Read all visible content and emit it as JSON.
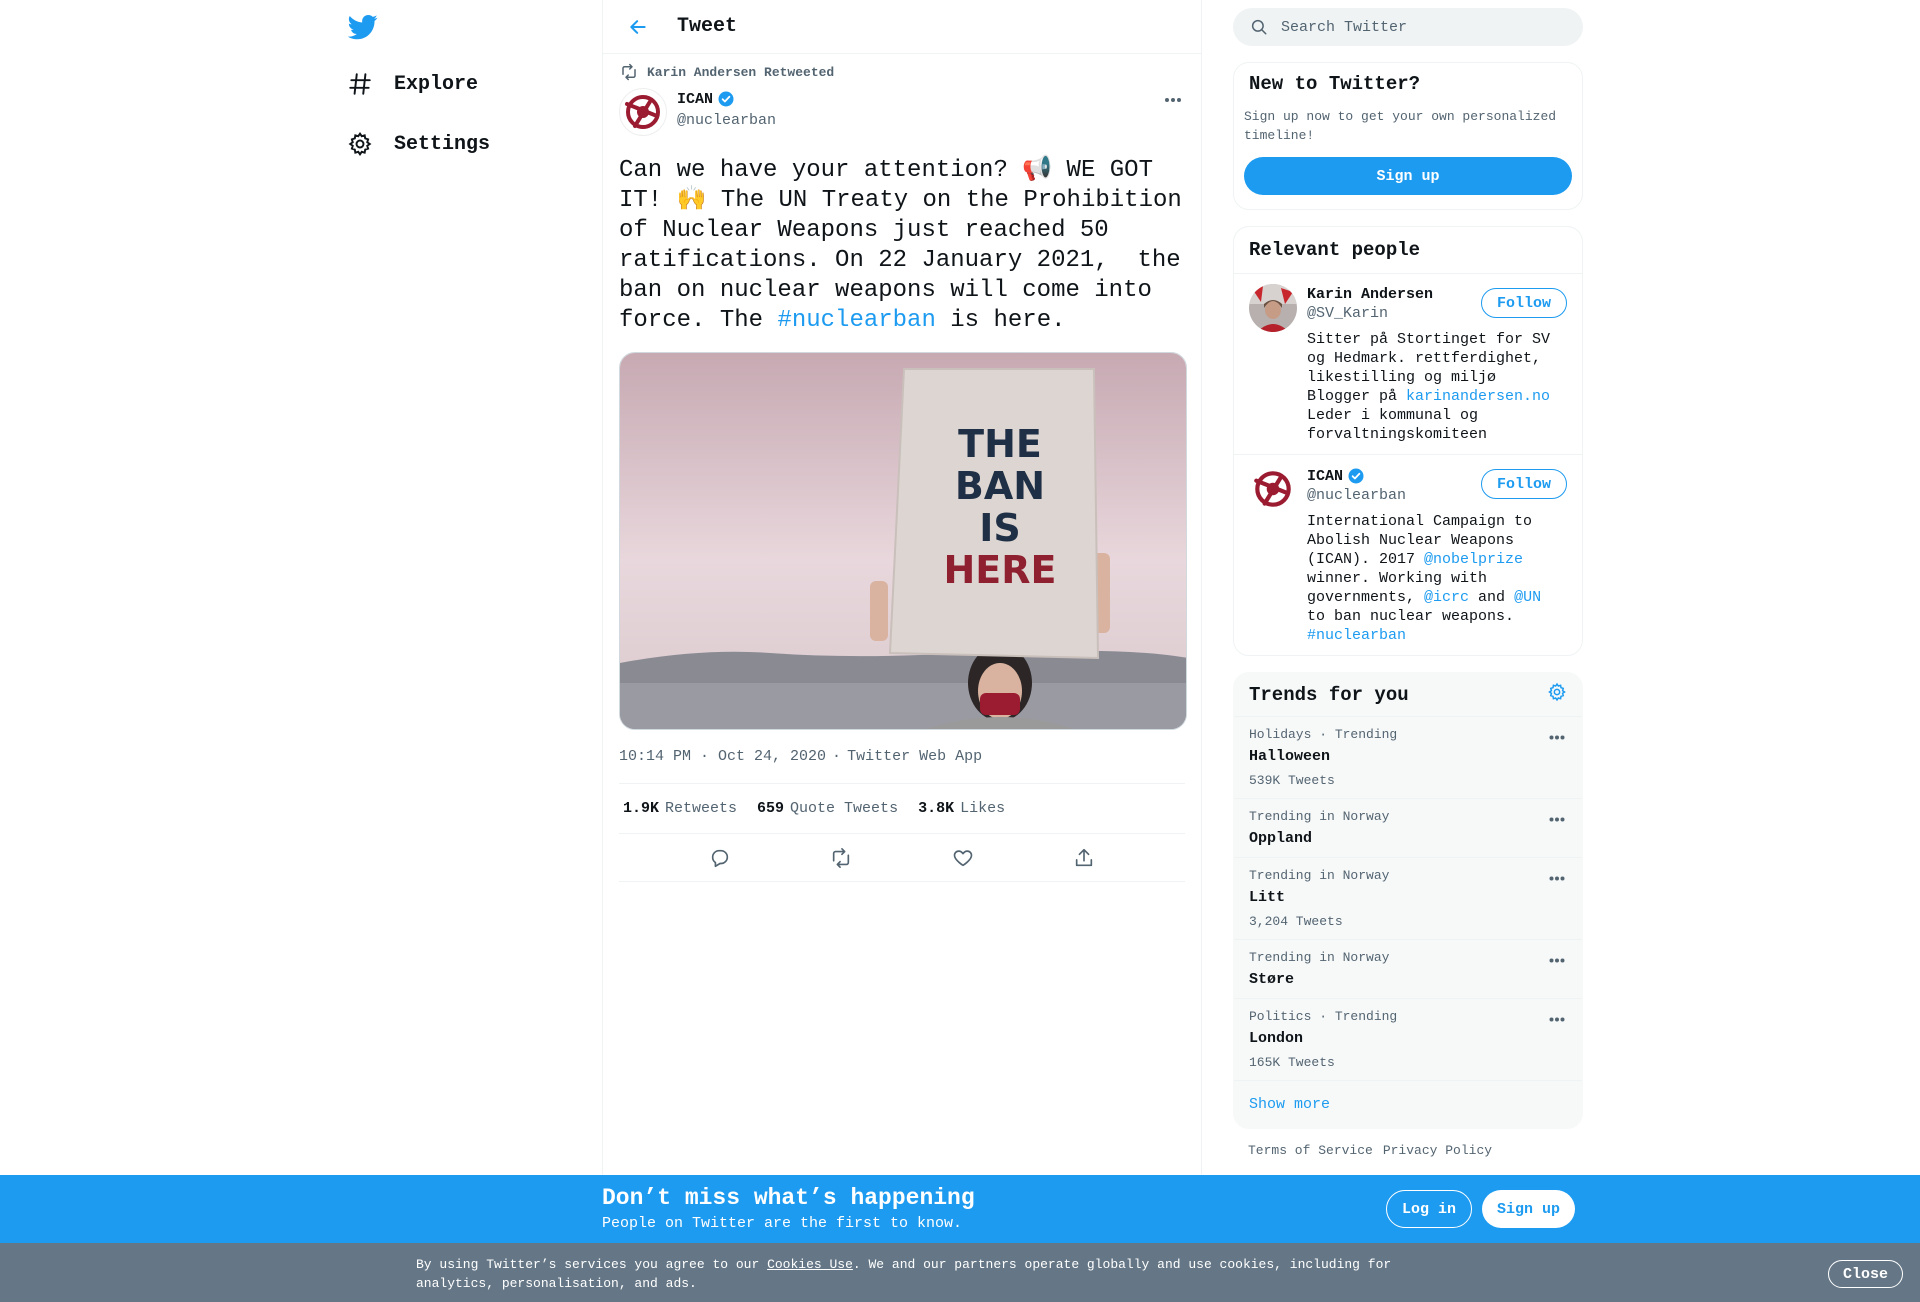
{
  "nav": {
    "logo_icon": "twitter-bird-icon",
    "items": [
      {
        "label": "Explore",
        "icon": "hashtag-icon"
      },
      {
        "label": "Settings",
        "icon": "gear-icon"
      }
    ]
  },
  "header": {
    "title": "Tweet",
    "back_icon": "arrow-left-icon"
  },
  "tweet": {
    "retweeted_by": "Karin Andersen Retweeted",
    "author_name": "ICAN",
    "author_handle": "@nuclearban",
    "text_before": "Can we have your attention? 📢 WE GOT IT! 🙌 The UN Treaty on the Prohibition of Nuclear Weapons just reached 50 ratifications. On 22 January 2021,  the ban on nuclear weapons will come into force. The ",
    "hashtag": "#nuclearban",
    "text_after": " is here.",
    "sign_lines": [
      "THE",
      "BAN",
      "IS",
      "HERE"
    ],
    "time": "10:14 PM · Oct 24, 2020",
    "source": "Twitter Web App",
    "stats": [
      {
        "value": "1.9K",
        "label": "Retweets"
      },
      {
        "value": "659",
        "label": "Quote Tweets"
      },
      {
        "value": "3.8K",
        "label": "Likes"
      }
    ]
  },
  "search": {
    "placeholder": "Search Twitter"
  },
  "new_to_twitter": {
    "title": "New to Twitter?",
    "subtitle": "Sign up now to get your own personalized timeline!",
    "button": "Sign up"
  },
  "relevant_people": {
    "title": "Relevant people",
    "people": [
      {
        "name": "Karin Andersen",
        "handle": "@SV_Karin",
        "follow": "Follow",
        "bio_1": "Sitter på Stortinget for SV og Hedmark. rettferdighet, likestilling og miljø Blogger på ",
        "bio_link": "karinandersen.no",
        "bio_2": " Leder i kommunal og forvaltningskomiteen"
      },
      {
        "name": "ICAN",
        "handle": "@nuclearban",
        "follow": "Follow",
        "bio_1": "International Campaign to Abolish Nuclear Weapons (ICAN). 2017 ",
        "bio_link_1": "@nobelprize",
        "bio_2": " winner. Working with governments, ",
        "bio_link_2": "@icrc",
        "bio_3": " and ",
        "bio_link_3": "@UN",
        "bio_4": " to ban nuclear weapons. ",
        "bio_link_4": "#nuclearban"
      }
    ]
  },
  "trends": {
    "title": "Trends for you",
    "items": [
      {
        "context": "Holidays · Trending",
        "name": "Halloween",
        "count": "539K Tweets"
      },
      {
        "context": "Trending in Norway",
        "name": "Oppland",
        "count": ""
      },
      {
        "context": "Trending in Norway",
        "name": "Litt",
        "count": "3,204 Tweets"
      },
      {
        "context": "Trending in Norway",
        "name": "Støre",
        "count": ""
      },
      {
        "context": "Politics · Trending",
        "name": "London",
        "count": "165K Tweets"
      }
    ],
    "show_more": "Show more"
  },
  "footer": {
    "links": [
      "Terms of Service",
      "Privacy Policy"
    ]
  },
  "signup_bar": {
    "title": "Don’t miss what’s happening",
    "subtitle": "People on Twitter are the first to know.",
    "login": "Log in",
    "signup": "Sign up"
  },
  "cookie_bar": {
    "text_before": "By using Twitter’s services you agree to our ",
    "link": "Cookies Use",
    "text_after": ". We and our partners operate globally and use cookies, including for analytics, personalisation, and ads.",
    "close": "Close"
  },
  "colors": {
    "accent": "#1d9bf0",
    "ican_red": "#9b1b30",
    "text": "#0f1419",
    "muted": "#536471"
  }
}
